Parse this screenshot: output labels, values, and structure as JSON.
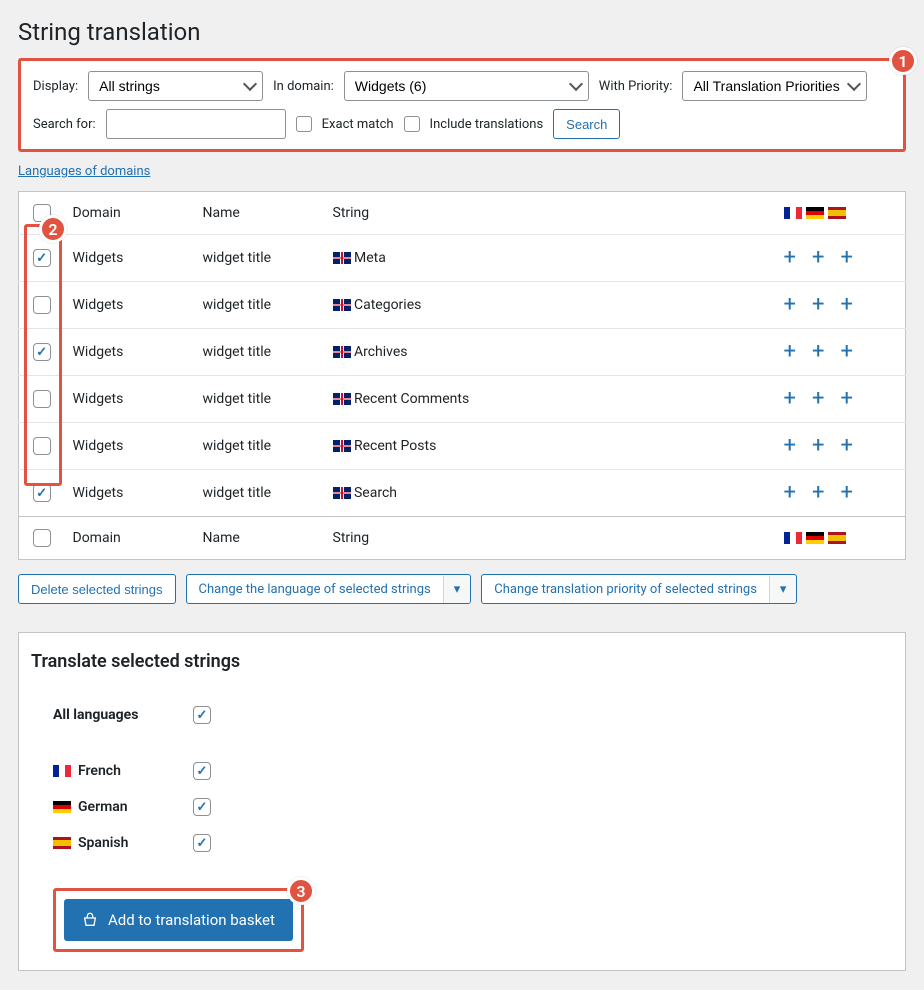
{
  "page_title": "String translation",
  "filters": {
    "display_label": "Display:",
    "display_value": "All strings",
    "domain_label": "In domain:",
    "domain_value": "Widgets (6)",
    "priority_label": "With Priority:",
    "priority_value": "All Translation Priorities",
    "search_label": "Search for:",
    "exact_match_label": "Exact match",
    "include_translations_label": "Include translations",
    "search_button": "Search"
  },
  "languages_link": "Languages of domains",
  "columns": {
    "domain": "Domain",
    "name": "Name",
    "string": "String"
  },
  "header_flags": [
    "fr",
    "de",
    "es"
  ],
  "rows": [
    {
      "checked": true,
      "domain": "Widgets",
      "name": "widget title",
      "string": "Meta"
    },
    {
      "checked": false,
      "domain": "Widgets",
      "name": "widget title",
      "string": "Categories"
    },
    {
      "checked": true,
      "domain": "Widgets",
      "name": "widget title",
      "string": "Archives"
    },
    {
      "checked": false,
      "domain": "Widgets",
      "name": "widget title",
      "string": "Recent Comments"
    },
    {
      "checked": false,
      "domain": "Widgets",
      "name": "widget title",
      "string": "Recent Posts"
    },
    {
      "checked": true,
      "domain": "Widgets",
      "name": "widget title",
      "string": "Search"
    }
  ],
  "actions": {
    "delete": "Delete selected strings",
    "change_lang": "Change the language of selected strings",
    "change_priority": "Change translation priority of selected strings"
  },
  "translate_panel": {
    "title": "Translate selected strings",
    "all_languages": "All languages",
    "languages": [
      {
        "flag": "fr",
        "name": "French",
        "checked": true
      },
      {
        "flag": "de",
        "name": "German",
        "checked": true
      },
      {
        "flag": "es",
        "name": "Spanish",
        "checked": true
      }
    ],
    "all_checked": true,
    "add_button": "Add to translation basket"
  },
  "annotations": {
    "n1": "1",
    "n2": "2",
    "n3": "3"
  }
}
